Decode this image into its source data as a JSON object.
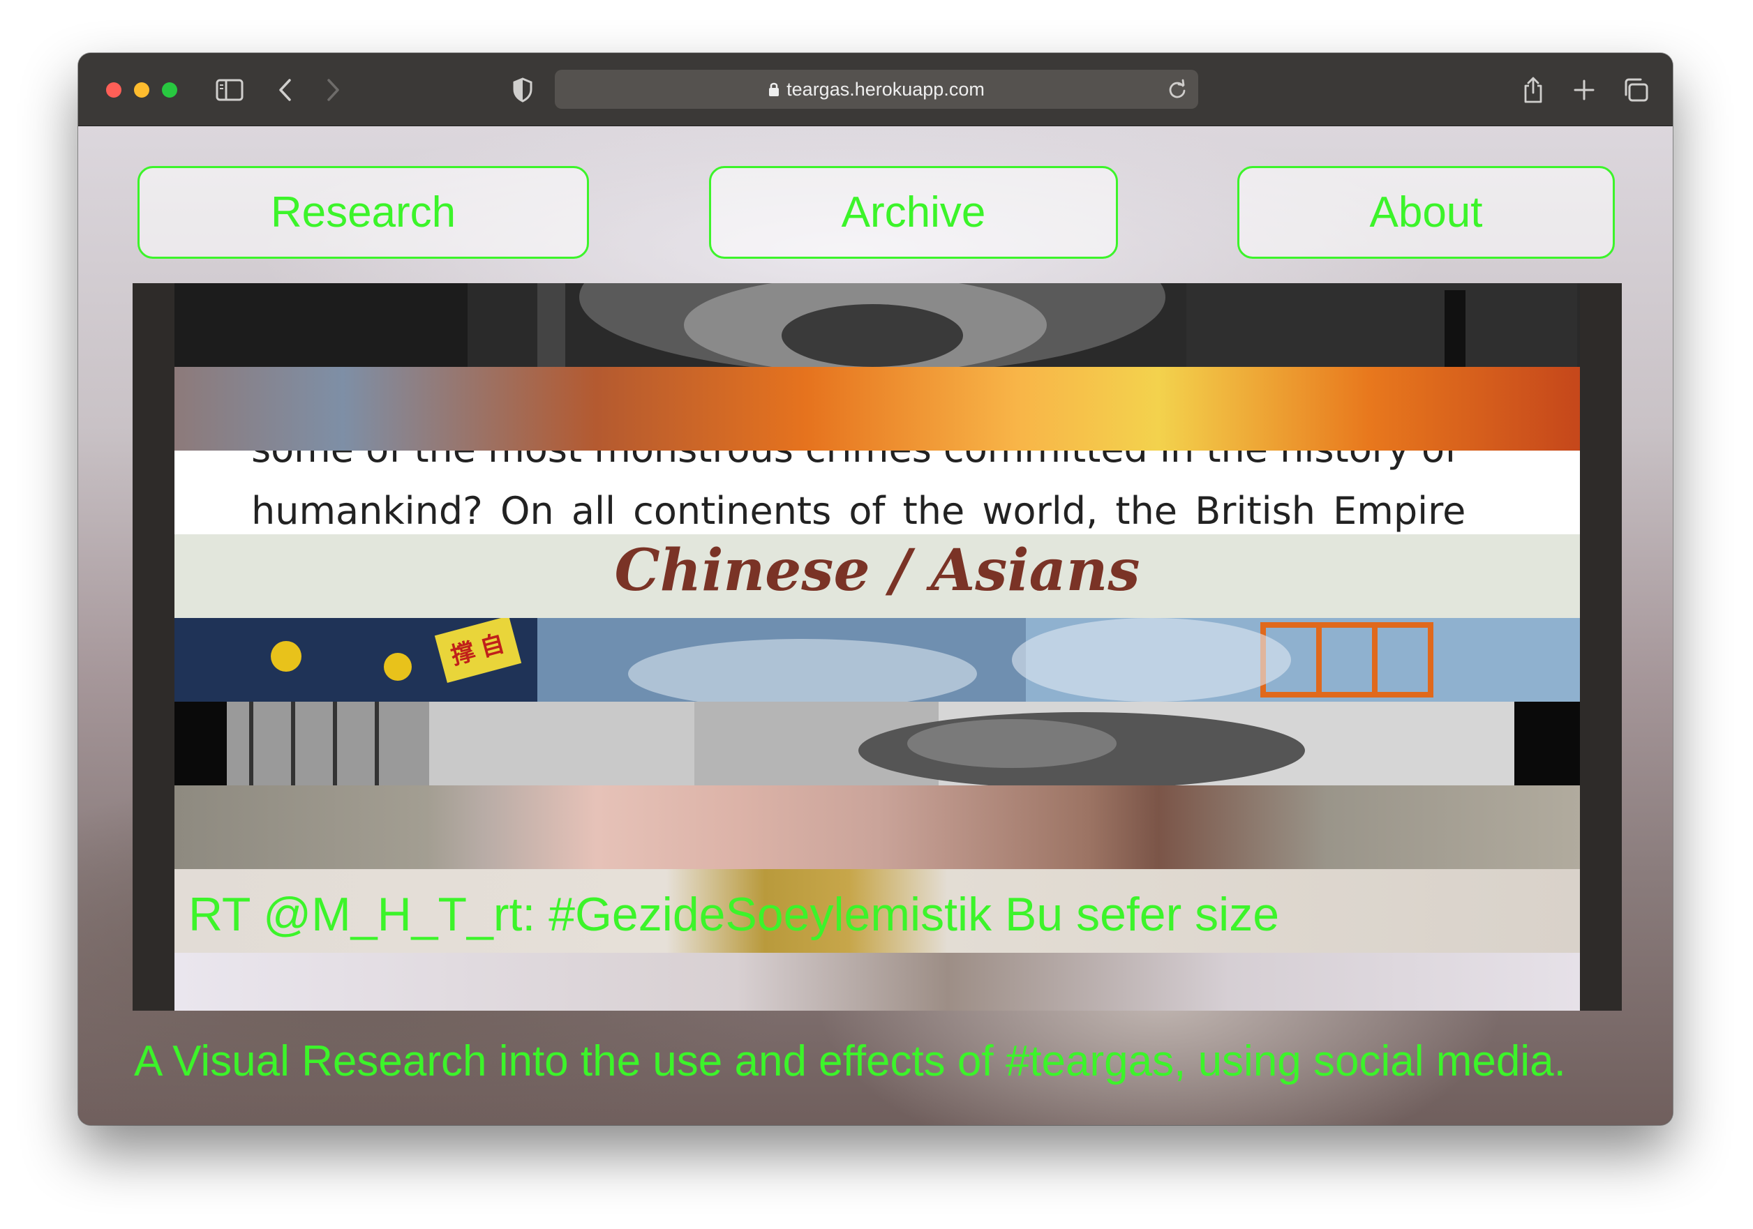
{
  "browser": {
    "url": "teargas.herokuapp.com"
  },
  "nav": {
    "research_label": "Research",
    "archive_label": "Archive",
    "about_label": "About"
  },
  "collage": {
    "text_strip_lines": [
      "some of the most monstrous crimes committed in the history of",
      "humankind? On all continents of the world, the British Empire"
    ],
    "banner_text": "Chinese / Asians",
    "protest_sign_text": "撑 自",
    "tweet_text": "RT @M_H_T_rt: #GezideSoeylemistik Bu sefer size"
  },
  "tagline": "A Visual Research into the use and effects of #teargas, using social media.",
  "colors": {
    "accent_green": "#3cf42a",
    "titlebar": "#3b3937",
    "banner_text": "#7a3326"
  },
  "icons": [
    "sidebar-toggle-icon",
    "back-icon",
    "forward-icon",
    "privacy-shield-icon",
    "lock-icon",
    "reload-icon",
    "share-icon",
    "new-tab-icon",
    "tab-overview-icon"
  ]
}
